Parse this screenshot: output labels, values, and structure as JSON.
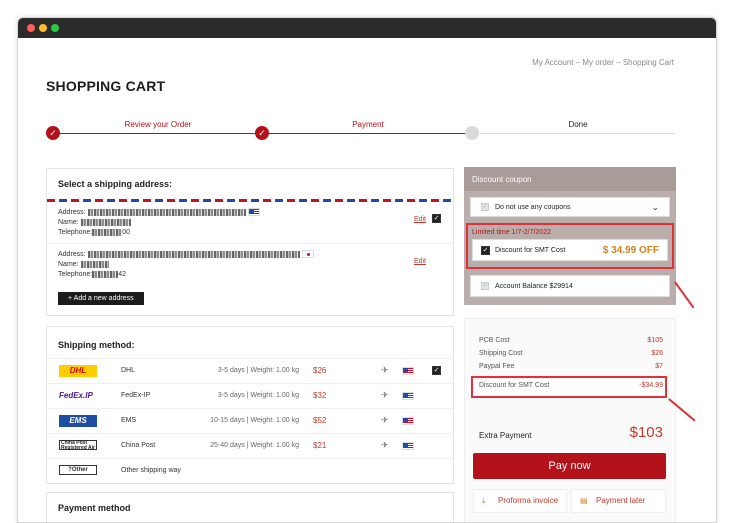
{
  "breadcrumb": "My Account  –  My order  –  Shopping Cart",
  "page_title": "SHOPPING CART",
  "steps": [
    "Review your Order",
    "Payment",
    "Done"
  ],
  "address_section": {
    "heading": "Select a shipping address:",
    "labels": {
      "address": "Address:",
      "name": "Name:",
      "telephone": "Telephone:"
    },
    "address1_tel_tail": "00",
    "address2_tel_tail": "42",
    "edit_label": "Edit",
    "add_button": "+ Add a new address"
  },
  "shipping": {
    "heading": "Shipping method:",
    "methods": [
      {
        "logo": "DHL",
        "name": "DHL",
        "days": "3-5 days | Weight: 1.00 kg",
        "price": "$26",
        "checked": true
      },
      {
        "logo": "FedEx.IP",
        "name": "FedEx-IP",
        "days": "3-5 days | Weight: 1.00 kg",
        "price": "$32",
        "checked": false
      },
      {
        "logo": "EMS",
        "name": "EMS",
        "days": "10-15 days | Weight: 1.00 kg",
        "price": "$52",
        "checked": false
      },
      {
        "logo": "China Post Registered Air",
        "name": "China Post",
        "days": "25-40 days | Weight: 1.00 kg",
        "price": "$21",
        "checked": false
      },
      {
        "logo": "?Other",
        "name": "Other shipping way",
        "days": "",
        "price": "",
        "checked": false
      }
    ]
  },
  "payment_method_heading": "Payment method",
  "coupon": {
    "heading": "Discount coupon",
    "select_value": "Do not use any coupons",
    "promo_label": "Limited time 1/7-2/7/2022",
    "promo_name": "Discount for SMT Cost",
    "promo_amount": "$ 34.99 OFF",
    "balance": "Account Balance $29914"
  },
  "summary": {
    "pcb_label": "PCB Cost",
    "pcb_value": "$105",
    "ship_label": "Shipping Cost",
    "ship_value": "$26",
    "paypal_label": "Paypal Fee",
    "paypal_value": "$7",
    "smt_label": "Discount for SMT Cost",
    "smt_value": "-$34.99",
    "extra_label": "Extra Payment",
    "extra_value": "$103",
    "pay_now": "Pay now",
    "proforma": "Proforma invoice",
    "pay_later": "Payment later"
  },
  "colors": {
    "brand_red": "#b3121a",
    "highlight_red": "#e03039",
    "coupon_panel": "#b9aeac",
    "amount_orange": "#d4821f"
  },
  "icons": [
    "check-icon",
    "chevron-down-icon",
    "plane-icon",
    "us-flag-icon",
    "jp-flag-icon",
    "download-icon",
    "invoice-icon"
  ]
}
